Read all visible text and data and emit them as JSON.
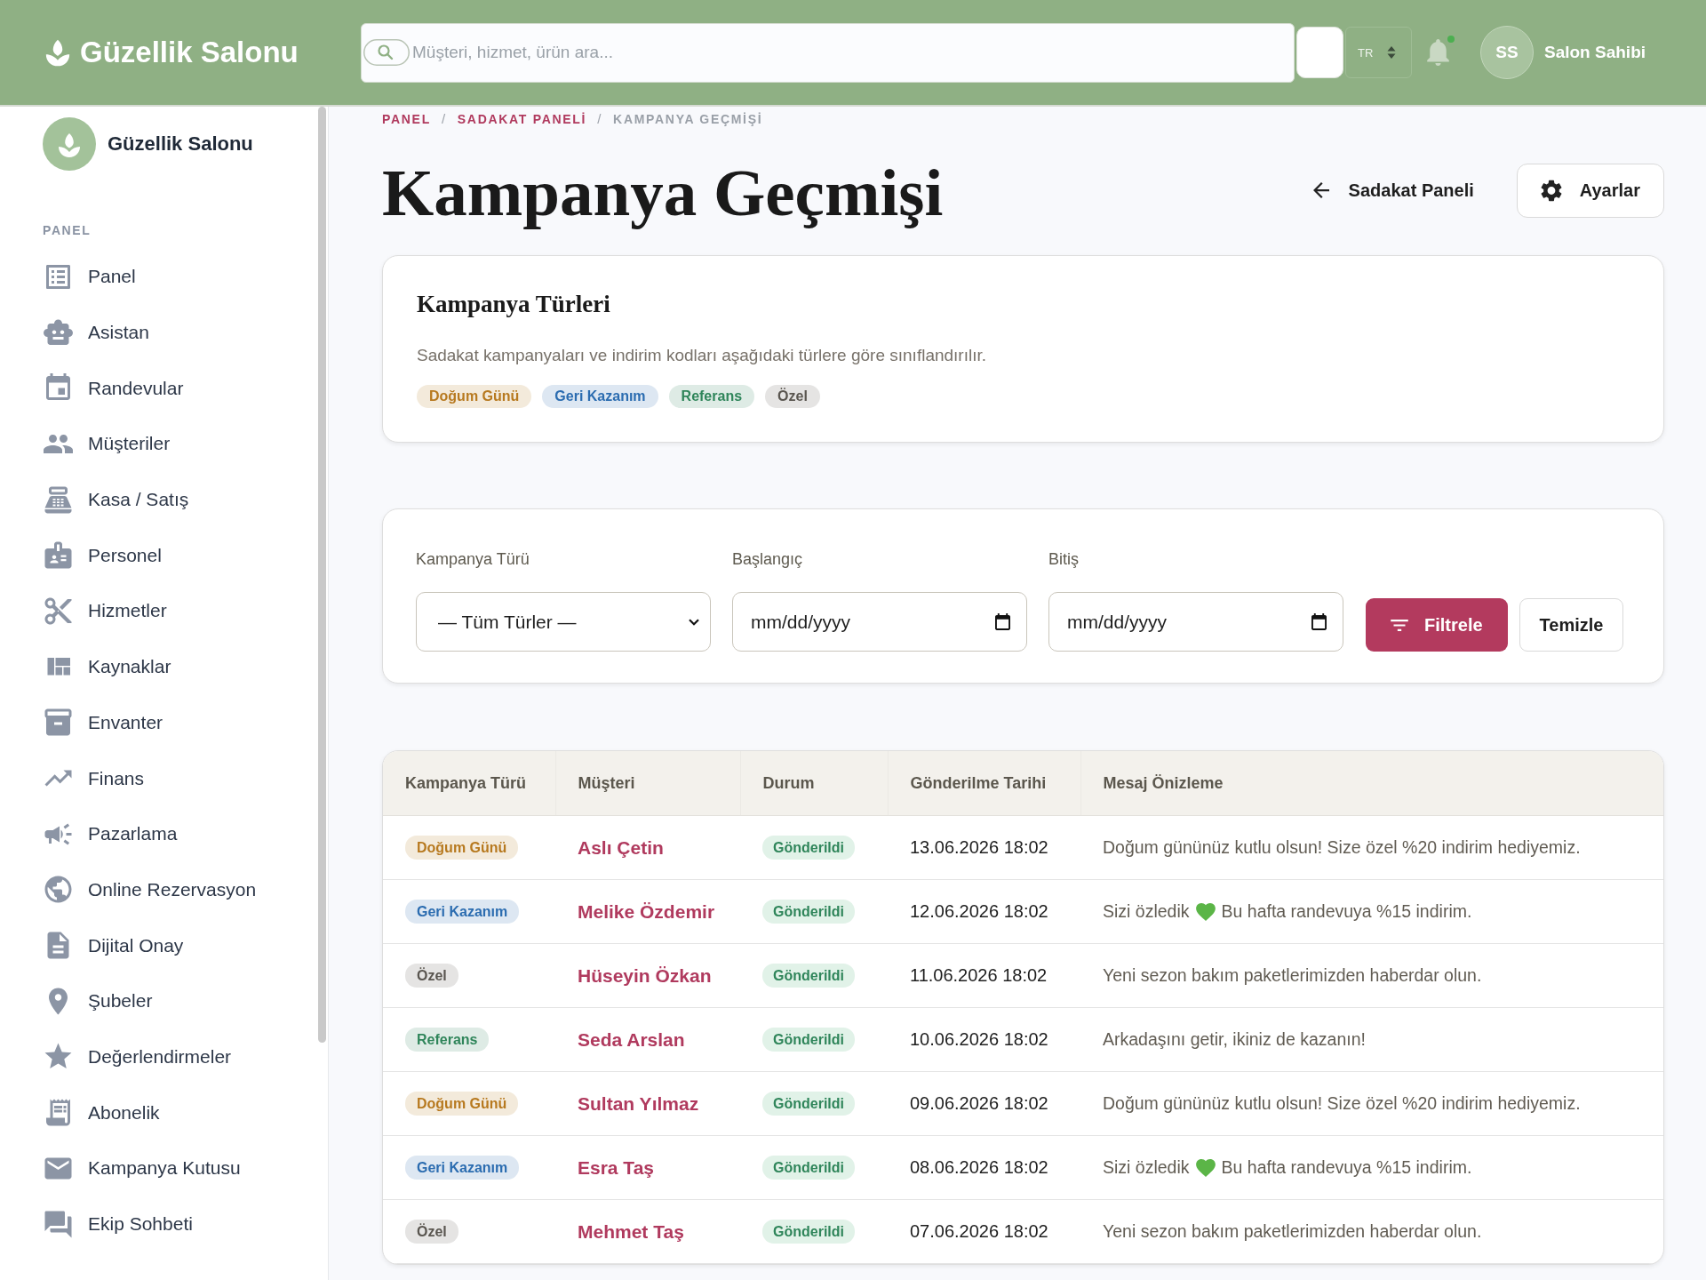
{
  "topbar": {
    "brand": "Güzellik Salonu",
    "search": {
      "placeholder": "Müşteri, hizmet, ürün ara..."
    },
    "language": "TR",
    "notifications": {
      "unread": true
    },
    "user": {
      "initials": "SS",
      "name": "Salon Sahibi"
    }
  },
  "sidebar": {
    "brand": "Güzellik Salonu",
    "section": "PANEL",
    "items": [
      {
        "label": "Panel"
      },
      {
        "label": "Asistan"
      },
      {
        "label": "Randevular"
      },
      {
        "label": "Müşteriler"
      },
      {
        "label": "Kasa / Satış"
      },
      {
        "label": "Personel"
      },
      {
        "label": "Hizmetler"
      },
      {
        "label": "Kaynaklar"
      },
      {
        "label": "Envanter"
      },
      {
        "label": "Finans"
      },
      {
        "label": "Pazarlama"
      },
      {
        "label": "Online Rezervasyon"
      },
      {
        "label": "Dijital Onay"
      },
      {
        "label": "Şubeler"
      },
      {
        "label": "Değerlendirmeler"
      },
      {
        "label": "Abonelik"
      },
      {
        "label": "Kampanya Kutusu"
      },
      {
        "label": "Ekip Sohbeti"
      }
    ]
  },
  "breadcrumb": {
    "items": [
      {
        "label": "PANEL",
        "current": false
      },
      {
        "separator": "/",
        "label": "SADAKAT PANELİ",
        "current": false
      },
      {
        "separator": "/",
        "label": "KAMPANYA GEÇMİŞİ",
        "current": true
      }
    ]
  },
  "page": {
    "title": "Kampanya Geçmişi",
    "back_link": "Sadakat Paneli",
    "settings_button": "Ayarlar"
  },
  "types_card": {
    "title": "Kampanya Türleri",
    "description": "Sadakat kampanyaları ve indirim kodları aşağıdaki türlere göre sınıflandırılır.",
    "tags": [
      {
        "label": "Doğum Günü",
        "color": "#b7791f"
      },
      {
        "label": "Geri Kazanım",
        "color": "#2b6cb0"
      },
      {
        "label": "Referans",
        "color": "#2f855a"
      },
      {
        "label": "Özel",
        "color": "#5a5650"
      }
    ]
  },
  "filters": {
    "fields": [
      {
        "kind": "select",
        "label": "Kampanya Türü",
        "value": "— Tüm Türler —"
      },
      {
        "kind": "date",
        "label": "Başlangıç",
        "placeholder": "mm/dd/yyyy"
      },
      {
        "kind": "date",
        "label": "Bitiş",
        "placeholder": "mm/dd/yyyy"
      }
    ],
    "buttons": [
      {
        "kind": "primary",
        "label": "Filtrele"
      },
      {
        "kind": "secondary",
        "label": "Temizle"
      }
    ]
  },
  "table": {
    "columns": [
      "Kampanya Türü",
      "Müşteri",
      "Durum",
      "Gönderilme Tarihi",
      "Mesaj Önizleme"
    ],
    "rows": [
      {
        "type": {
          "label": "Doğum Günü",
          "color": "#b7791f"
        },
        "customer": "Aslı Çetin",
        "status": "Gönderildi",
        "sent_at": "13.06.2026 18:02",
        "message": [
          {
            "kind": "text",
            "text": "Doğum gününüz kutlu olsun! Size özel %20 indirim hediyemiz."
          }
        ]
      },
      {
        "type": {
          "label": "Geri Kazanım",
          "color": "#2b6cb0"
        },
        "customer": "Melike Özdemir",
        "status": "Gönderildi",
        "sent_at": "12.06.2026 18:02",
        "message": [
          {
            "kind": "text",
            "text": "Sizi özledik"
          },
          {
            "kind": "emoji"
          },
          {
            "kind": "text",
            "text": "Bu hafta randevuya %15 indirim."
          }
        ]
      },
      {
        "type": {
          "label": "Özel",
          "color": "#5a5650"
        },
        "customer": "Hüseyin Özkan",
        "status": "Gönderildi",
        "sent_at": "11.06.2026 18:02",
        "message": [
          {
            "kind": "text",
            "text": "Yeni sezon bakım paketlerimizden haberdar olun."
          }
        ]
      },
      {
        "type": {
          "label": "Referans",
          "color": "#2f855a"
        },
        "customer": "Seda Arslan",
        "status": "Gönderildi",
        "sent_at": "10.06.2026 18:02",
        "message": [
          {
            "kind": "text",
            "text": "Arkadaşını getir, ikiniz de kazanın!"
          }
        ]
      },
      {
        "type": {
          "label": "Doğum Günü",
          "color": "#b7791f"
        },
        "customer": "Sultan Yılmaz",
        "status": "Gönderildi",
        "sent_at": "09.06.2026 18:02",
        "message": [
          {
            "kind": "text",
            "text": "Doğum gününüz kutlu olsun! Size özel %20 indirim hediyemiz."
          }
        ]
      },
      {
        "type": {
          "label": "Geri Kazanım",
          "color": "#2b6cb0"
        },
        "customer": "Esra Taş",
        "status": "Gönderildi",
        "sent_at": "08.06.2026 18:02",
        "message": [
          {
            "kind": "text",
            "text": "Sizi özledik"
          },
          {
            "kind": "emoji"
          },
          {
            "kind": "text",
            "text": "Bu hafta randevuya %15 indirim."
          }
        ]
      },
      {
        "type": {
          "label": "Özel",
          "color": "#5a5650"
        },
        "customer": "Mehmet Taş",
        "status": "Gönderildi",
        "sent_at": "07.06.2026 18:02",
        "message": [
          {
            "kind": "text",
            "text": "Yeni sezon bakım paketlerimizden haberdar olun."
          }
        ]
      }
    ]
  }
}
